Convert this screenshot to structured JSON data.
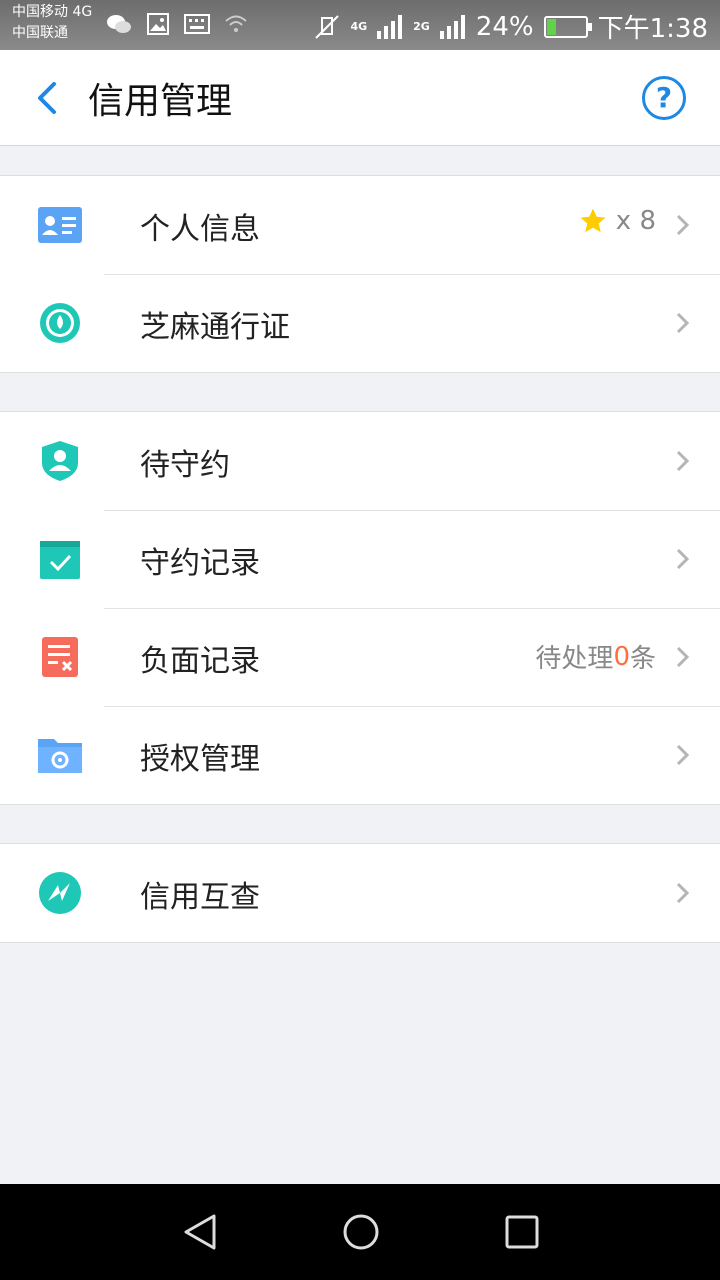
{
  "status_bar": {
    "carrier1": "中国移动 4G",
    "carrier2": "中国联通",
    "net1": "4G",
    "net2": "2G",
    "battery": "24%",
    "battery_level": 0.24,
    "time": "下午1:38"
  },
  "header": {
    "title": "信用管理",
    "help": "?"
  },
  "groups": [
    {
      "items": [
        {
          "label": "个人信息",
          "icon": "id-card-icon",
          "badge": "x 8"
        },
        {
          "label": "芝麻通行证",
          "icon": "sesame-pass-icon"
        }
      ]
    },
    {
      "items": [
        {
          "label": "待守约",
          "icon": "shield-user-icon"
        },
        {
          "label": "守约记录",
          "icon": "calendar-check-icon"
        },
        {
          "label": "负面记录",
          "icon": "document-x-icon",
          "status_prefix": "待处理",
          "status_count": "0",
          "status_suffix": "条"
        },
        {
          "label": "授权管理",
          "icon": "folder-gear-icon"
        }
      ]
    },
    {
      "items": [
        {
          "label": "信用互查",
          "icon": "credit-check-icon"
        }
      ]
    }
  ],
  "colors": {
    "accent_blue": "#1e88e5",
    "teal": "#1fc7b6",
    "red": "#f66b5c",
    "star": "#ffcc00",
    "orange": "#ff6f3c"
  }
}
